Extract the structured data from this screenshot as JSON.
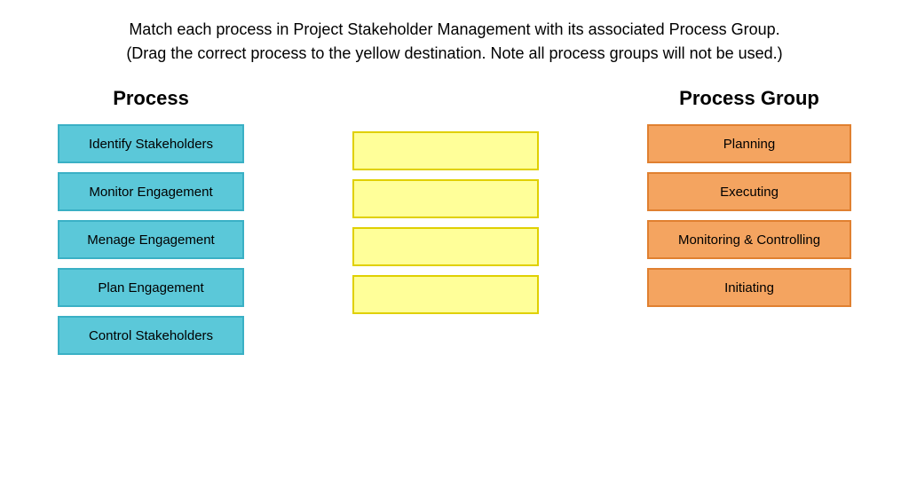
{
  "instruction": {
    "line1": "Match each process in Project Stakeholder Management with its",
    "line2": "associated Process Group. (Drag the correct process to the yellow",
    "line3": "destination.  Note all process groups will not be used.)",
    "full": "Match each process in Project Stakeholder Management with its associated Process Group. (Drag the correct process to the yellow destination.  Note all process groups will not be used.)"
  },
  "process_column": {
    "header": "Process",
    "items": [
      {
        "id": "p1",
        "label": "Identify Stakeholders"
      },
      {
        "id": "p2",
        "label": "Monitor Engagement"
      },
      {
        "id": "p3",
        "label": "Menage Engagement"
      },
      {
        "id": "p4",
        "label": "Plan Engagement"
      },
      {
        "id": "p5",
        "label": "Control Stakeholders"
      }
    ]
  },
  "process_group_column": {
    "header": "Process Group",
    "items": [
      {
        "id": "g1",
        "label": "Planning"
      },
      {
        "id": "g2",
        "label": "Executing"
      },
      {
        "id": "g3",
        "label": "Monitoring & Controlling"
      },
      {
        "id": "g4",
        "label": "Initiating"
      }
    ]
  },
  "drop_zones": [
    {
      "id": "dz1"
    },
    {
      "id": "dz2"
    },
    {
      "id": "dz3"
    },
    {
      "id": "dz4"
    }
  ]
}
